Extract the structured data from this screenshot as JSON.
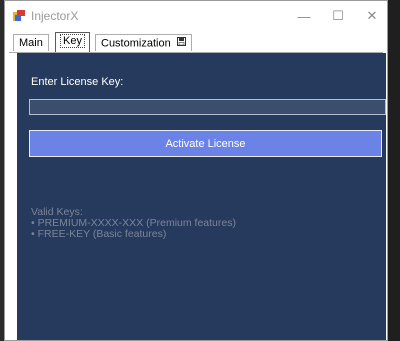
{
  "window": {
    "title": "InjectorX",
    "minimize_glyph": "—",
    "maximize_glyph": "☐",
    "close_glyph": "✕"
  },
  "tabs": [
    {
      "label": "Main",
      "selected": false
    },
    {
      "label": "Key",
      "selected": true
    },
    {
      "label": "Customization",
      "icon": "floppy-disk-icon",
      "selected": false
    }
  ],
  "key_tab": {
    "prompt": "Enter License Key:",
    "input_value": "",
    "activate_label": "Activate License",
    "valid_keys": {
      "heading": "Valid Keys:",
      "items": [
        "• PREMIUM-XXXX-XXX (Premium features)",
        "• FREE-KEY (Basic features)"
      ]
    }
  },
  "colors": {
    "panel_bg": "#263a5e",
    "button_bg": "#6b83e6",
    "input_bg": "#3b4e6e",
    "muted_text": "#7b8597"
  }
}
